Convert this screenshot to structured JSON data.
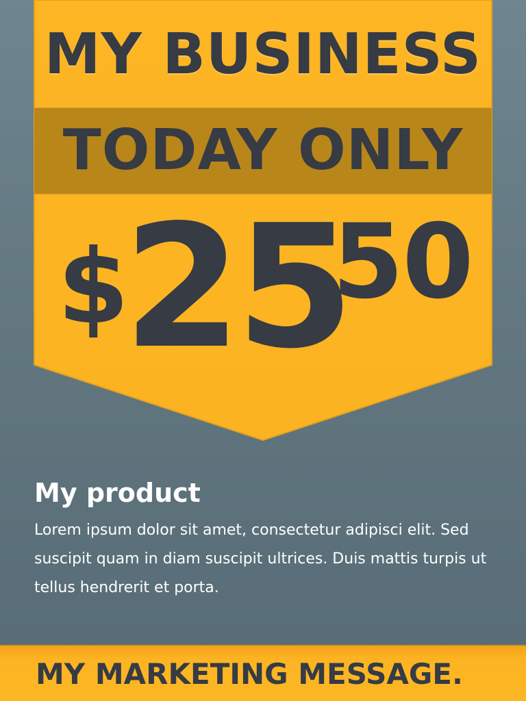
{
  "banner": {
    "business_name": "MY BUSINESS",
    "offer": "TODAY ONLY",
    "price": {
      "symbol": "$",
      "whole": "25",
      "cents": "50"
    }
  },
  "product": {
    "title": "My product",
    "description": "Lorem ipsum dolor sit amet, consectetur adipisci elit. Sed suscipit quam in diam suscipit ultrices. Duis mattis turpis ut tellus hendrerit et porta."
  },
  "footer": {
    "message": "MY MARKETING MESSAGE."
  },
  "colors": {
    "accent": "#fdb723",
    "accent_dark": "#b9861a",
    "text_dark": "#363b44",
    "background": "#62777f"
  }
}
